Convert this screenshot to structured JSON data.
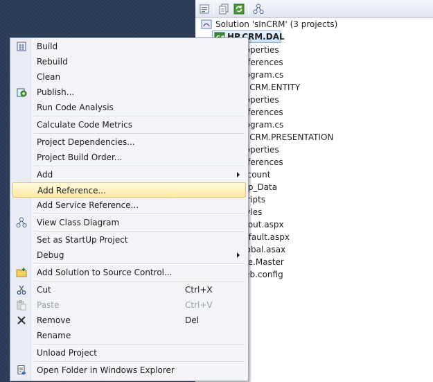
{
  "colors": {
    "ide_background": "#2b3c59",
    "menu_background": "#f2f4f8",
    "highlight": "#fde9a8",
    "disabled_text": "#9a9ea6"
  },
  "explorer": {
    "toolbar_icons": [
      "properties-icon",
      "show-all-files-icon",
      "refresh-icon",
      "class-diagram-icon"
    ],
    "solution_label": "Solution 'sInCRM' (3 projects)",
    "selected_node": "HP.CRM.DAL",
    "rows": [
      "Properties",
      "References",
      "Program.cs",
      "HP.CRM.ENTITY",
      "Properties",
      "References",
      "Program.cs",
      "HP.CRM.PRESENTATION",
      "Properties",
      "References",
      "Account",
      "App_Data",
      "Scripts",
      "Styles",
      "About.aspx",
      "Default.aspx",
      "Global.asax",
      "Site.Master",
      "Web.config"
    ]
  },
  "menu": {
    "build": "Build",
    "rebuild": "Rebuild",
    "clean": "Clean",
    "publish": "Publish...",
    "run_code_analysis": "Run Code Analysis",
    "calculate_code_metrics": "Calculate Code Metrics",
    "project_dependencies": "Project Dependencies...",
    "project_build_order": "Project Build Order...",
    "add": "Add",
    "add_reference": "Add Reference...",
    "add_service_reference": "Add Service Reference...",
    "view_class_diagram": "View Class Diagram",
    "set_startup": "Set as StartUp Project",
    "debug": "Debug",
    "add_to_source_control": "Add Solution to Source Control...",
    "cut": "Cut",
    "cut_shortcut": "Ctrl+X",
    "paste": "Paste",
    "paste_shortcut": "Ctrl+V",
    "remove": "Remove",
    "remove_shortcut": "Del",
    "rename": "Rename",
    "unload_project": "Unload Project",
    "open_folder": "Open Folder in Windows Explorer"
  }
}
